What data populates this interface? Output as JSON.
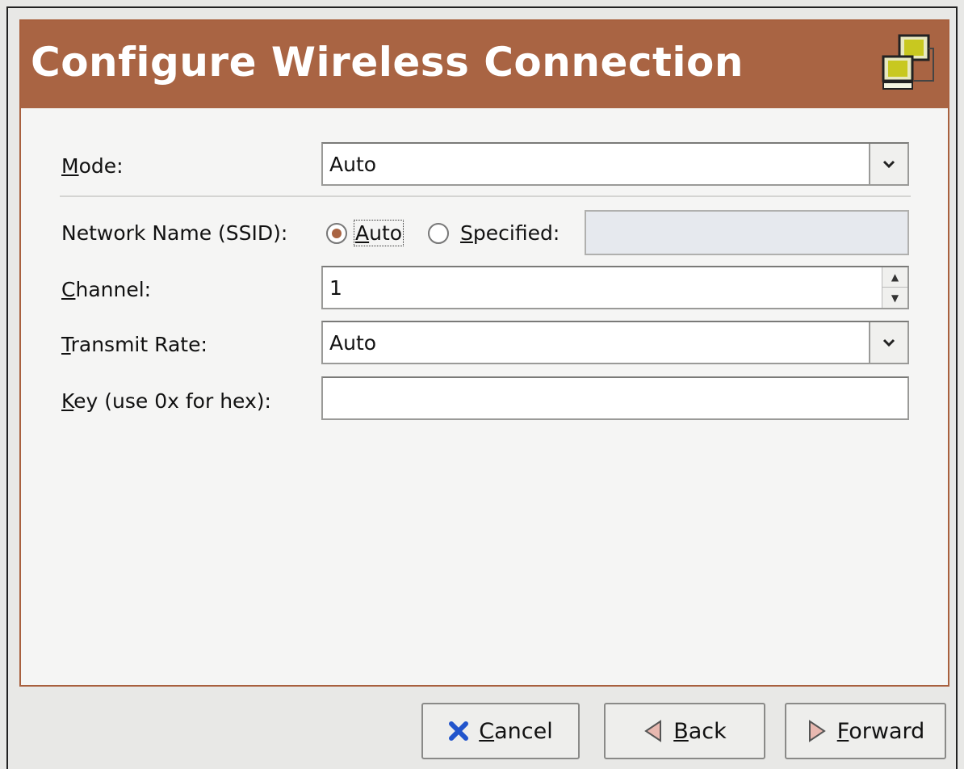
{
  "header": {
    "title": "Configure Wireless Connection",
    "icon": "network-computers-icon",
    "color": "#a96443"
  },
  "form": {
    "mode": {
      "label_mnemonic": "M",
      "label_rest": "ode:",
      "value": "Auto"
    },
    "ssid": {
      "label": "Network Name (SSID):",
      "options": [
        {
          "mnemonic": "A",
          "rest": "uto",
          "selected": true
        },
        {
          "mnemonic": "S",
          "rest": "pecified:",
          "selected": false
        }
      ],
      "specified_value": ""
    },
    "channel": {
      "label_mnemonic": "C",
      "label_rest": "hannel:",
      "value": "1"
    },
    "transmit_rate": {
      "label_mnemonic": "T",
      "label_rest": "ransmit Rate:",
      "value": "Auto"
    },
    "key": {
      "label_mnemonic": "K",
      "label_rest": "ey (use 0x for hex):",
      "value": ""
    }
  },
  "buttons": {
    "cancel": {
      "mnemonic": "C",
      "rest": "ancel",
      "icon": "close-x-icon"
    },
    "back": {
      "mnemonic": "B",
      "rest": "ack",
      "icon": "back-arrow-icon"
    },
    "forward": {
      "mnemonic": "F",
      "rest": "orward",
      "icon": "forward-arrow-icon"
    }
  }
}
